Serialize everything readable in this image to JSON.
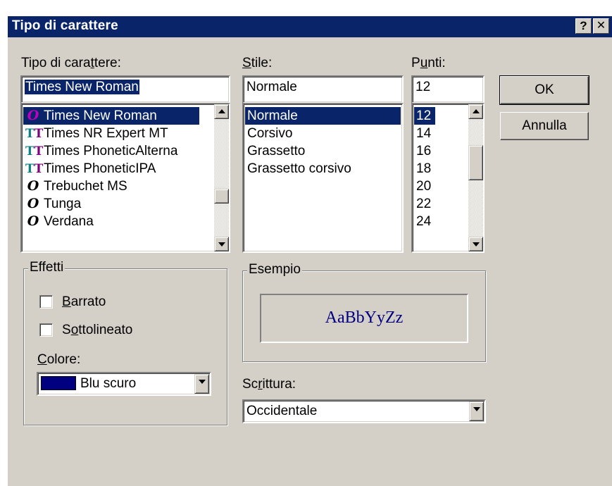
{
  "window": {
    "title": "Tipo di carattere",
    "help_glyph": "?",
    "close_glyph": "✕"
  },
  "font": {
    "label_pre": "Tipo di cara",
    "label_key": "t",
    "label_post": "tere:",
    "value": "Times New Roman",
    "items": [
      {
        "name": "Times New Roman",
        "icon": "opentype-font-icon",
        "glyph": "O",
        "selected": true
      },
      {
        "name": "Times NR Expert MT",
        "icon": "truetype-font-icon",
        "glyph": "TT",
        "selected": false
      },
      {
        "name": "Times PhoneticAlterna",
        "icon": "truetype-font-icon",
        "glyph": "TT",
        "selected": false
      },
      {
        "name": "Times PhoneticIPA",
        "icon": "truetype-font-icon",
        "glyph": "TT",
        "selected": false
      },
      {
        "name": "Trebuchet MS",
        "icon": "opentype-font-icon",
        "glyph": "O",
        "selected": false
      },
      {
        "name": "Tunga",
        "icon": "opentype-font-icon",
        "glyph": "O",
        "selected": false
      },
      {
        "name": "Verdana",
        "icon": "opentype-font-icon",
        "glyph": "O",
        "selected": false
      }
    ]
  },
  "style": {
    "label_key": "S",
    "label_post": "tile:",
    "value": "Normale",
    "items": [
      {
        "name": "Normale",
        "selected": true
      },
      {
        "name": "Corsivo",
        "selected": false
      },
      {
        "name": "Grassetto",
        "selected": false
      },
      {
        "name": "Grassetto corsivo",
        "selected": false
      }
    ]
  },
  "size": {
    "label_pre": "P",
    "label_key": "u",
    "label_post": "nti:",
    "value": "12",
    "items": [
      {
        "name": "12",
        "selected": true
      },
      {
        "name": "14",
        "selected": false
      },
      {
        "name": "16",
        "selected": false
      },
      {
        "name": "18",
        "selected": false
      },
      {
        "name": "20",
        "selected": false
      },
      {
        "name": "22",
        "selected": false
      },
      {
        "name": "24",
        "selected": false
      }
    ]
  },
  "buttons": {
    "ok": "OK",
    "cancel": "Annulla"
  },
  "effects": {
    "group_label": "Effetti",
    "strike_key": "B",
    "strike_post": "arrato",
    "strike_checked": false,
    "underline_pre": "S",
    "underline_key": "o",
    "underline_post": "ttolineato",
    "underline_checked": false,
    "color_key": "C",
    "color_post": "olore:",
    "color_value": "Blu scuro",
    "color_swatch": "#000080"
  },
  "sample": {
    "group_label": "Esempio",
    "text": "AaBbYyZz",
    "text_color": "#000080"
  },
  "script": {
    "label_pre": "Sc",
    "label_key": "r",
    "label_post": "ittura:",
    "value": "Occidentale"
  },
  "colors": {
    "titlebar": "#0a246a",
    "face": "#d4d0c8",
    "selection": "#0a246a"
  }
}
